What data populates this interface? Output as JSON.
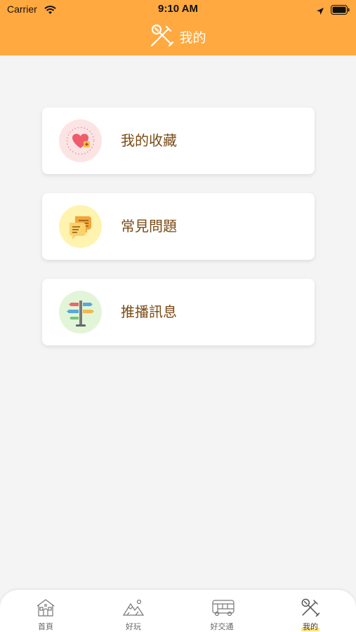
{
  "status_bar": {
    "carrier": "Carrier",
    "time": "9:10 AM"
  },
  "header": {
    "title": "我的",
    "icon": "tools-icon"
  },
  "menu": [
    {
      "label": "我的收藏",
      "icon": "heart-icon",
      "circle_color": "#fde4e4"
    },
    {
      "label": "常見問題",
      "icon": "chat-bubbles-icon",
      "circle_color": "#fff3b0"
    },
    {
      "label": "推播訊息",
      "icon": "signpost-icon",
      "circle_color": "#e2f5d8"
    }
  ],
  "tabbar": {
    "tabs": [
      {
        "label": "首頁",
        "icon": "house-icon"
      },
      {
        "label": "好玩",
        "icon": "mountain-icon"
      },
      {
        "label": "好交通",
        "icon": "bus-icon"
      },
      {
        "label": "我的",
        "icon": "tools-icon",
        "active": true
      }
    ]
  },
  "colors": {
    "accent": "#ffa940",
    "label_text": "#7a4b14",
    "background": "#f4f4f4"
  }
}
